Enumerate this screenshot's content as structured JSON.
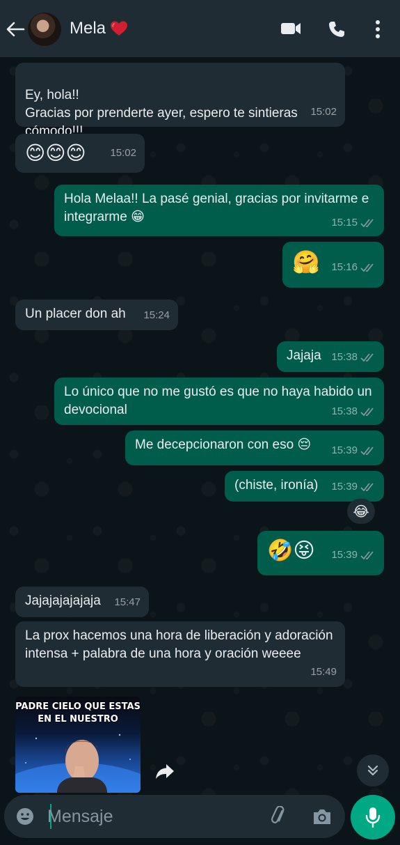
{
  "header": {
    "contact_name": "Mela",
    "icons": [
      "back-arrow-icon",
      "avatar",
      "heart-icon",
      "video-call-icon",
      "phone-call-icon",
      "more-vert-icon"
    ]
  },
  "colors": {
    "header_bg": "#1f2c34",
    "incoming_bubble": "#1f2c34",
    "outgoing_bubble": "#005c4b",
    "accent": "#00a884",
    "read_ticks": "#8696a0"
  },
  "messages": [
    {
      "dir": "in",
      "text": "Ey, hola!!\nGracias por prenderte ayer, espero te sintieras cómodo!!!",
      "time": "15:02"
    },
    {
      "dir": "in",
      "text": "😊😊😊",
      "time": "15:02"
    },
    {
      "dir": "out",
      "text": "Hola Melaa!! La pasé genial, gracias por invitarme e integrarme 😁",
      "time": "15:15"
    },
    {
      "dir": "out",
      "text": "🤗",
      "time": "15:16"
    },
    {
      "dir": "in",
      "text": "Un placer don ah",
      "time": "15:24"
    },
    {
      "dir": "out",
      "text": "Jajaja",
      "time": "15:38"
    },
    {
      "dir": "out",
      "text": "Lo único que no me gustó es que no haya habido un devocional",
      "time": "15:38"
    },
    {
      "dir": "out",
      "text": "Me decepcionaron con eso 😔",
      "time": "15:39"
    },
    {
      "dir": "out",
      "text": "(chiste, ironía)",
      "time": "15:39",
      "reaction": "😂"
    },
    {
      "dir": "out",
      "text": "🤣😝",
      "time": "15:39"
    },
    {
      "dir": "in",
      "text": "Jajajajajajaja",
      "time": "15:47"
    },
    {
      "dir": "in",
      "text": "La prox hacemos una hora de liberación y adoración intensa + palabra de una hora y oración weeee",
      "time": "15:49"
    }
  ],
  "media": {
    "caption": "PADRE CIELO QUE ESTAS EN EL NUESTRO"
  },
  "input": {
    "placeholder": "Mensaje"
  }
}
